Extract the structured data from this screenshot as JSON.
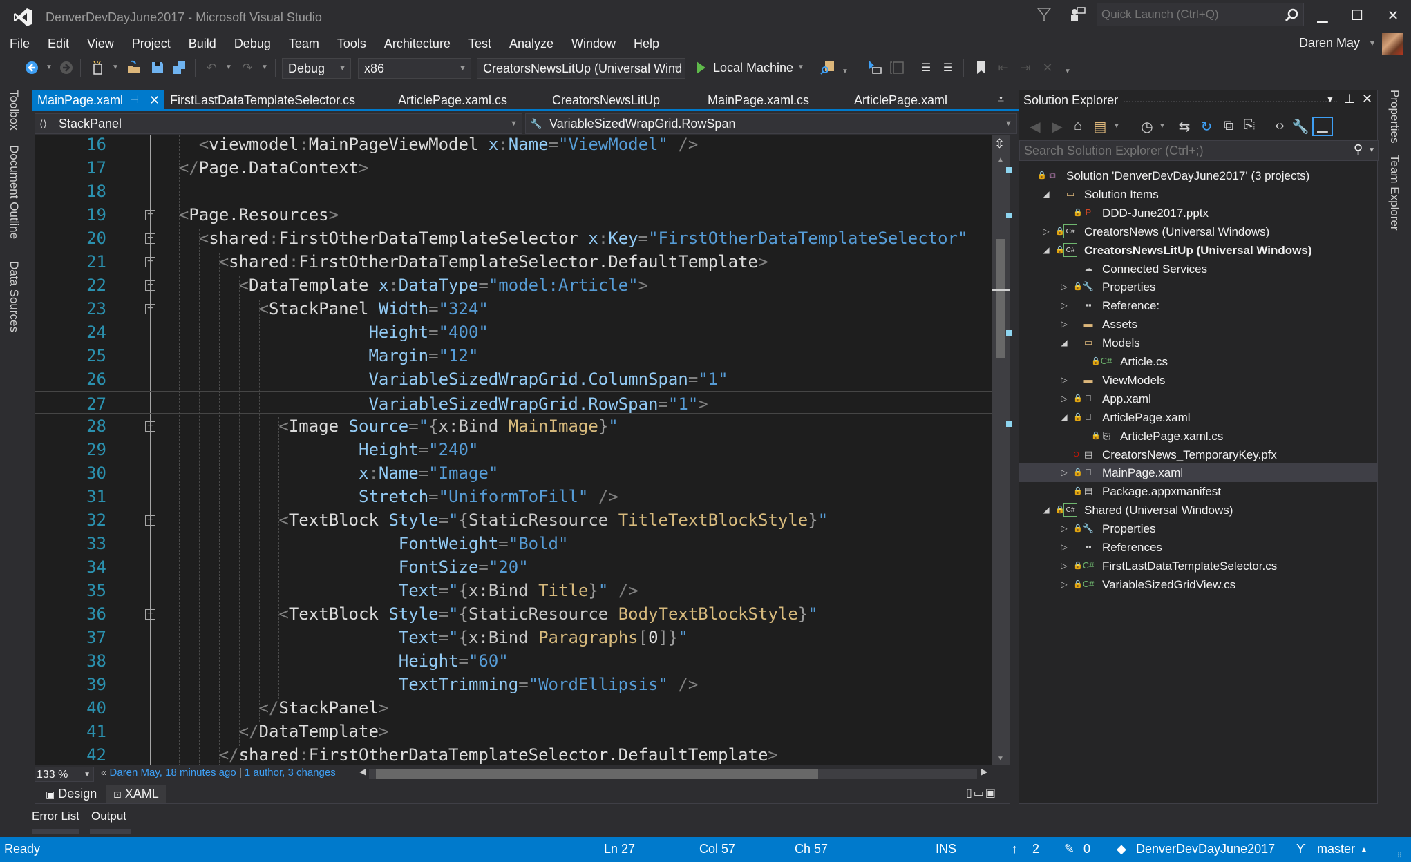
{
  "window": {
    "title": "DenverDevDayJune2017 - Microsoft Visual Studio",
    "quick_launch_placeholder": "Quick Launch (Ctrl+Q)",
    "user_name": "Daren May"
  },
  "menu": [
    "File",
    "Edit",
    "View",
    "Project",
    "Build",
    "Debug",
    "Team",
    "Tools",
    "Architecture",
    "Test",
    "Analyze",
    "Window",
    "Help"
  ],
  "toolbar": {
    "configuration": "Debug",
    "platform": "x86",
    "startup_project": "CreatorsNewsLitUp (Universal Wind",
    "run_target": "Local Machine"
  },
  "left_side_tabs": [
    "Toolbox",
    "Document Outline",
    "Data Sources"
  ],
  "right_side_tabs": [
    "Properties",
    "Team Explorer"
  ],
  "editor": {
    "tabs": [
      {
        "label": "MainPage.xaml",
        "active": true,
        "pinned": true
      },
      {
        "label": "FirstLastDataTemplateSelector.cs"
      },
      {
        "label": "ArticlePage.xaml.cs"
      },
      {
        "label": "CreatorsNewsLitUp"
      },
      {
        "label": "MainPage.xaml.cs"
      },
      {
        "label": "ArticlePage.xaml"
      }
    ],
    "nav_left": "StackPanel",
    "nav_right": "VariableSizedWrapGrid.RowSpan",
    "current_line": 27,
    "lines": [
      {
        "n": "16",
        "fold": false,
        "indent": 4,
        "tokens": [
          [
            "p",
            "<"
          ],
          [
            "e",
            "viewmodel"
          ],
          [
            "p",
            ":"
          ],
          [
            "e",
            "MainPageViewModel"
          ],
          [
            "t",
            " "
          ],
          [
            "a",
            "x"
          ],
          [
            "p",
            ":"
          ],
          [
            "a",
            "Name"
          ],
          [
            "p",
            "="
          ],
          [
            "s",
            "\"ViewModel\""
          ],
          [
            "t",
            " "
          ],
          [
            "p",
            "/>"
          ]
        ]
      },
      {
        "n": "17",
        "fold": false,
        "indent": 2,
        "tokens": [
          [
            "p",
            "</"
          ],
          [
            "e",
            "Page.DataContext"
          ],
          [
            "p",
            ">"
          ]
        ]
      },
      {
        "n": "18",
        "fold": false,
        "indent": 0,
        "tokens": []
      },
      {
        "n": "19",
        "fold": true,
        "indent": 2,
        "tokens": [
          [
            "p",
            "<"
          ],
          [
            "e",
            "Page.Resources"
          ],
          [
            "p",
            ">"
          ]
        ]
      },
      {
        "n": "20",
        "fold": true,
        "indent": 4,
        "tokens": [
          [
            "p",
            "<"
          ],
          [
            "e",
            "shared"
          ],
          [
            "p",
            ":"
          ],
          [
            "e",
            "FirstOtherDataTemplateSelector"
          ],
          [
            "t",
            " "
          ],
          [
            "a",
            "x"
          ],
          [
            "p",
            ":"
          ],
          [
            "a",
            "Key"
          ],
          [
            "p",
            "="
          ],
          [
            "s",
            "\"FirstOtherDataTemplateSelector\""
          ]
        ]
      },
      {
        "n": "21",
        "fold": true,
        "indent": 6,
        "tokens": [
          [
            "p",
            "<"
          ],
          [
            "e",
            "shared"
          ],
          [
            "p",
            ":"
          ],
          [
            "e",
            "FirstOtherDataTemplateSelector.DefaultTemplate"
          ],
          [
            "p",
            ">"
          ]
        ]
      },
      {
        "n": "22",
        "fold": true,
        "indent": 8,
        "tokens": [
          [
            "p",
            "<"
          ],
          [
            "e",
            "DataTemplate"
          ],
          [
            "t",
            " "
          ],
          [
            "a",
            "x"
          ],
          [
            "p",
            ":"
          ],
          [
            "a",
            "DataType"
          ],
          [
            "p",
            "="
          ],
          [
            "s",
            "\"model:Article\""
          ],
          [
            "p",
            ">"
          ]
        ]
      },
      {
        "n": "23",
        "fold": true,
        "indent": 10,
        "tokens": [
          [
            "p",
            "<"
          ],
          [
            "e",
            "StackPanel"
          ],
          [
            "t",
            " "
          ],
          [
            "a",
            "Width"
          ],
          [
            "p",
            "="
          ],
          [
            "s",
            "\"324\""
          ]
        ]
      },
      {
        "n": "24",
        "fold": false,
        "indent": 21,
        "tokens": [
          [
            "a",
            "Height"
          ],
          [
            "p",
            "="
          ],
          [
            "s",
            "\"400\""
          ]
        ]
      },
      {
        "n": "25",
        "fold": false,
        "indent": 21,
        "tokens": [
          [
            "a",
            "Margin"
          ],
          [
            "p",
            "="
          ],
          [
            "s",
            "\"12\""
          ]
        ]
      },
      {
        "n": "26",
        "fold": false,
        "indent": 21,
        "tokens": [
          [
            "a",
            "VariableSizedWrapGrid.ColumnSpan"
          ],
          [
            "p",
            "="
          ],
          [
            "s",
            "\"1\""
          ]
        ]
      },
      {
        "n": "27",
        "fold": false,
        "indent": 21,
        "tokens": [
          [
            "a",
            "VariableSizedWrapGrid.RowSpan"
          ],
          [
            "p",
            "="
          ],
          [
            "s",
            "\"1\""
          ],
          [
            "p",
            ">"
          ]
        ]
      },
      {
        "n": "28",
        "fold": true,
        "indent": 12,
        "tokens": [
          [
            "p",
            "<"
          ],
          [
            "e",
            "Image"
          ],
          [
            "t",
            " "
          ],
          [
            "a",
            "Source"
          ],
          [
            "p",
            "="
          ],
          [
            "s",
            "\""
          ],
          [
            "b",
            "{"
          ],
          [
            "x",
            "x:Bind"
          ],
          [
            "t",
            " "
          ],
          [
            "k",
            "MainImage"
          ],
          [
            "b",
            "}"
          ],
          [
            "s",
            "\""
          ]
        ]
      },
      {
        "n": "29",
        "fold": false,
        "indent": 20,
        "tokens": [
          [
            "a",
            "Height"
          ],
          [
            "p",
            "="
          ],
          [
            "s",
            "\"240\""
          ]
        ]
      },
      {
        "n": "30",
        "fold": false,
        "indent": 20,
        "tokens": [
          [
            "a",
            "x"
          ],
          [
            "p",
            ":"
          ],
          [
            "a",
            "Name"
          ],
          [
            "p",
            "="
          ],
          [
            "s",
            "\"Image\""
          ]
        ]
      },
      {
        "n": "31",
        "fold": false,
        "indent": 20,
        "tokens": [
          [
            "a",
            "Stretch"
          ],
          [
            "p",
            "="
          ],
          [
            "s",
            "\"UniformToFill\""
          ],
          [
            "t",
            " "
          ],
          [
            "p",
            "/>"
          ]
        ]
      },
      {
        "n": "32",
        "fold": true,
        "indent": 12,
        "tokens": [
          [
            "p",
            "<"
          ],
          [
            "e",
            "TextBlock"
          ],
          [
            "t",
            " "
          ],
          [
            "a",
            "Style"
          ],
          [
            "p",
            "="
          ],
          [
            "s",
            "\""
          ],
          [
            "b",
            "{"
          ],
          [
            "x",
            "StaticResource"
          ],
          [
            "t",
            " "
          ],
          [
            "k",
            "TitleTextBlockStyle"
          ],
          [
            "b",
            "}"
          ],
          [
            "s",
            "\""
          ]
        ]
      },
      {
        "n": "33",
        "fold": false,
        "indent": 24,
        "tokens": [
          [
            "a",
            "FontWeight"
          ],
          [
            "p",
            "="
          ],
          [
            "s",
            "\"Bold\""
          ]
        ]
      },
      {
        "n": "34",
        "fold": false,
        "indent": 24,
        "tokens": [
          [
            "a",
            "FontSize"
          ],
          [
            "p",
            "="
          ],
          [
            "s",
            "\"20\""
          ]
        ]
      },
      {
        "n": "35",
        "fold": false,
        "indent": 24,
        "tokens": [
          [
            "a",
            "Text"
          ],
          [
            "p",
            "="
          ],
          [
            "s",
            "\""
          ],
          [
            "b",
            "{"
          ],
          [
            "x",
            "x:Bind"
          ],
          [
            "t",
            " "
          ],
          [
            "k",
            "Title"
          ],
          [
            "b",
            "}"
          ],
          [
            "s",
            "\""
          ],
          [
            "t",
            " "
          ],
          [
            "p",
            "/>"
          ]
        ]
      },
      {
        "n": "36",
        "fold": true,
        "indent": 12,
        "tokens": [
          [
            "p",
            "<"
          ],
          [
            "e",
            "TextBlock"
          ],
          [
            "t",
            " "
          ],
          [
            "a",
            "Style"
          ],
          [
            "p",
            "="
          ],
          [
            "s",
            "\""
          ],
          [
            "b",
            "{"
          ],
          [
            "x",
            "StaticResource"
          ],
          [
            "t",
            " "
          ],
          [
            "k",
            "BodyTextBlockStyle"
          ],
          [
            "b",
            "}"
          ],
          [
            "s",
            "\""
          ]
        ]
      },
      {
        "n": "37",
        "fold": false,
        "indent": 24,
        "tokens": [
          [
            "a",
            "Text"
          ],
          [
            "p",
            "="
          ],
          [
            "s",
            "\""
          ],
          [
            "b",
            "{"
          ],
          [
            "x",
            "x:Bind"
          ],
          [
            "t",
            " "
          ],
          [
            "k",
            "Paragraphs"
          ],
          [
            "b",
            "["
          ],
          [
            "e",
            "0"
          ],
          [
            "b",
            "]"
          ],
          [
            "b",
            "}"
          ],
          [
            "s",
            "\""
          ]
        ]
      },
      {
        "n": "38",
        "fold": false,
        "indent": 24,
        "tokens": [
          [
            "a",
            "Height"
          ],
          [
            "p",
            "="
          ],
          [
            "s",
            "\"60\""
          ]
        ]
      },
      {
        "n": "39",
        "fold": false,
        "indent": 24,
        "tokens": [
          [
            "a",
            "TextTrimming"
          ],
          [
            "p",
            "="
          ],
          [
            "s",
            "\"WordEllipsis\""
          ],
          [
            "t",
            " "
          ],
          [
            "p",
            "/>"
          ]
        ]
      },
      {
        "n": "40",
        "fold": false,
        "indent": 10,
        "tokens": [
          [
            "p",
            "</"
          ],
          [
            "e",
            "StackPanel"
          ],
          [
            "p",
            ">"
          ]
        ]
      },
      {
        "n": "41",
        "fold": false,
        "indent": 8,
        "tokens": [
          [
            "p",
            "</"
          ],
          [
            "e",
            "DataTemplate"
          ],
          [
            "p",
            ">"
          ]
        ]
      },
      {
        "n": "42",
        "fold": false,
        "indent": 6,
        "tokens": [
          [
            "p",
            "</"
          ],
          [
            "e",
            "shared"
          ],
          [
            "p",
            ":"
          ],
          [
            "e",
            "FirstOtherDataTemplateSelector.DefaultTemplate"
          ],
          [
            "p",
            ">"
          ]
        ]
      }
    ],
    "zoom_level": "133 %",
    "git_author_info": "Daren May, 18 minutes ago",
    "git_changes_info": "1 author, 3 changes",
    "view_tabs": [
      "Design",
      "XAML"
    ]
  },
  "solution_explorer": {
    "title": "Solution Explorer",
    "search_placeholder": "Search Solution Explorer (Ctrl+;)",
    "items": [
      {
        "label": "Solution 'DenverDevDayJune2017' (3 projects)",
        "depth": 0,
        "expander": "",
        "icon": "solution",
        "lock": true
      },
      {
        "label": "Solution Items",
        "depth": 1,
        "expander": "expanded",
        "icon": "folder-open",
        "lock": false
      },
      {
        "label": "DDD-June2017.pptx",
        "depth": 2,
        "expander": "",
        "icon": "powerpoint",
        "lock": true
      },
      {
        "label": "CreatorsNews (Universal Windows)",
        "depth": 1,
        "expander": "collapsed",
        "icon": "csharp-project",
        "lock": true
      },
      {
        "label": "CreatorsNewsLitUp (Universal Windows)",
        "depth": 1,
        "expander": "expanded",
        "icon": "csharp-project",
        "lock": true,
        "bold": true
      },
      {
        "label": "Connected Services",
        "depth": 2,
        "expander": "",
        "icon": "connected-services",
        "lock": false
      },
      {
        "label": "Properties",
        "depth": 2,
        "expander": "collapsed",
        "icon": "wrench",
        "lock": true
      },
      {
        "label": "Reference:",
        "depth": 2,
        "expander": "collapsed",
        "icon": "references",
        "lock": false
      },
      {
        "label": "Assets",
        "depth": 2,
        "expander": "collapsed",
        "icon": "folder",
        "lock": false
      },
      {
        "label": "Models",
        "depth": 2,
        "expander": "expanded",
        "icon": "folder-open",
        "lock": false
      },
      {
        "label": "Article.cs",
        "depth": 3,
        "expander": "",
        "icon": "csharp-file",
        "lock": true
      },
      {
        "label": "ViewModels",
        "depth": 2,
        "expander": "collapsed",
        "icon": "folder",
        "lock": false
      },
      {
        "label": "App.xaml",
        "depth": 2,
        "expander": "collapsed",
        "icon": "xaml-file",
        "lock": true
      },
      {
        "label": "ArticlePage.xaml",
        "depth": 2,
        "expander": "expanded",
        "icon": "xaml-file",
        "lock": true
      },
      {
        "label": "ArticlePage.xaml.cs",
        "depth": 3,
        "expander": "",
        "icon": "code-behind",
        "lock": true
      },
      {
        "label": "CreatorsNews_TemporaryKey.pfx",
        "depth": 2,
        "expander": "",
        "icon": "certificate",
        "lock": false,
        "excluded": true
      },
      {
        "label": "MainPage.xaml",
        "depth": 2,
        "expander": "collapsed",
        "icon": "xaml-file",
        "lock": true,
        "selected": true
      },
      {
        "label": "Package.appxmanifest",
        "depth": 2,
        "expander": "",
        "icon": "manifest",
        "lock": true
      },
      {
        "label": "Shared (Universal Windows)",
        "depth": 1,
        "expander": "expanded",
        "icon": "csharp-project",
        "lock": true
      },
      {
        "label": "Properties",
        "depth": 2,
        "expander": "collapsed",
        "icon": "wrench",
        "lock": true
      },
      {
        "label": "References",
        "depth": 2,
        "expander": "collapsed",
        "icon": "references",
        "lock": false
      },
      {
        "label": "FirstLastDataTemplateSelector.cs",
        "depth": 2,
        "expander": "collapsed",
        "icon": "csharp-file",
        "lock": true
      },
      {
        "label": "VariableSizedGridView.cs",
        "depth": 2,
        "expander": "collapsed",
        "icon": "csharp-file",
        "lock": true
      }
    ]
  },
  "bottom_tool_tabs": [
    "Error List",
    "Output"
  ],
  "status_bar": {
    "state": "Ready",
    "line": "Ln 27",
    "col": "Col 57",
    "ch": "Ch 57",
    "mode": "INS",
    "pending_pushes": "2",
    "pending_changes": "0",
    "repository": "DenverDevDayJune2017",
    "branch": "master"
  },
  "colors": {
    "accent": "#007acc",
    "editor_bg": "#1e1e1e",
    "chrome_bg": "#2d2d30",
    "line_number": "#2b91af",
    "xaml_attribute": "#92caf4",
    "xaml_string": "#569cd6",
    "markup_extension_arg": "#d7ba7d"
  }
}
